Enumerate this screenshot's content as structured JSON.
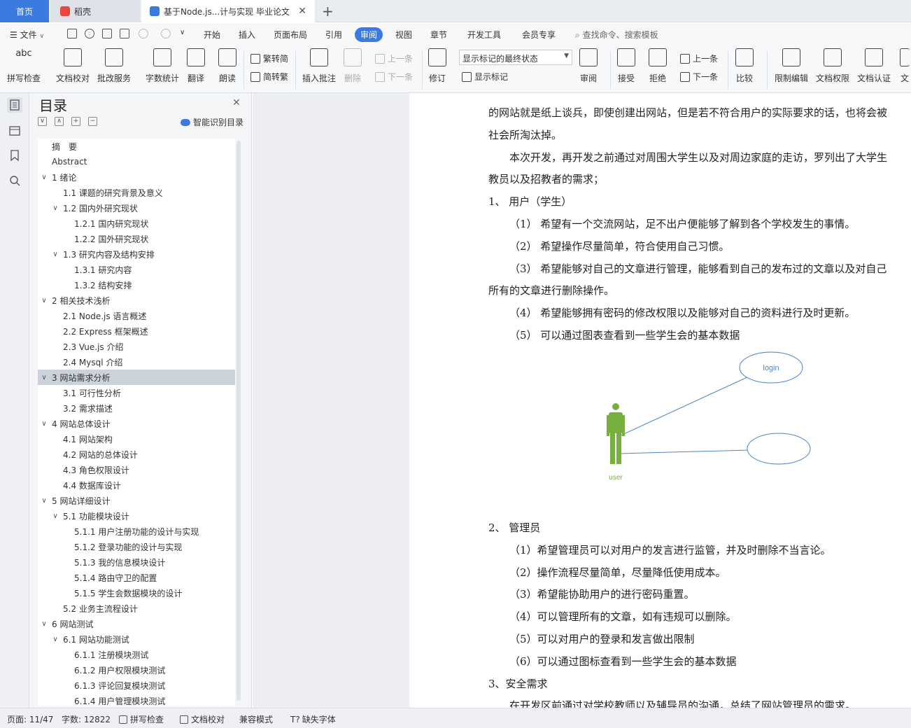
{
  "tabs": {
    "home": "首页",
    "daoke": "稻壳",
    "document": "基于Node.js...计与实现 毕业论文"
  },
  "menu": {
    "file": "文件",
    "items": [
      "开始",
      "插入",
      "页面布局",
      "引用",
      "审阅",
      "视图",
      "章节",
      "开发工具",
      "会员专享"
    ],
    "active": "审阅",
    "search_placeholder": "查找命令、搜索模板"
  },
  "ribbon": {
    "spell_check": "拼写检查",
    "doc_proofread": "文档校对",
    "batch_service": "批改服务",
    "word_count": "字数统计",
    "translate": "翻译",
    "read_aloud": "朗读",
    "to_traditional": "繁转简",
    "to_simplified": "简转繁",
    "insert_comment": "插入批注",
    "delete": "删除",
    "prev": "上一条",
    "next": "下一条",
    "revise": "修订",
    "markup_state": "显示标记的最终状态",
    "show_markup": "显示标记",
    "review": "审阅",
    "accept": "接受",
    "reject": "拒绝",
    "prev2": "上一条",
    "next2": "下一条",
    "compare": "比较",
    "restrict_edit": "限制编辑",
    "doc_rights": "文档权限",
    "doc_auth": "文档认证",
    "doc_cut": "文"
  },
  "toc": {
    "title": "目录",
    "smart": "智能识别目录",
    "items": [
      {
        "label": "摘　要",
        "level": 1,
        "chev": ""
      },
      {
        "label": "Abstract",
        "level": 1,
        "chev": ""
      },
      {
        "label": "1 绪论",
        "level": 1,
        "chev": "v"
      },
      {
        "label": "1.1  课题的研究背景及意义",
        "level": 2,
        "chev": ""
      },
      {
        "label": "1.2  国内外研究现状",
        "level": 2,
        "chev": "v"
      },
      {
        "label": "1.2.1 国内研究现状",
        "level": 3,
        "chev": ""
      },
      {
        "label": "1.2.2 国外研究现状",
        "level": 3,
        "chev": ""
      },
      {
        "label": "1.3  研究内容及结构安排",
        "level": 2,
        "chev": "v"
      },
      {
        "label": "1.3.1  研究内容",
        "level": 3,
        "chev": ""
      },
      {
        "label": "1.3.2  结构安排",
        "level": 3,
        "chev": ""
      },
      {
        "label": "2 相关技术浅析",
        "level": 1,
        "chev": "v"
      },
      {
        "label": "2.1 Node.js 语言概述",
        "level": 2,
        "chev": ""
      },
      {
        "label": "2.2 Express 框架概述",
        "level": 2,
        "chev": ""
      },
      {
        "label": "2.3 Vue.js 介绍",
        "level": 2,
        "chev": ""
      },
      {
        "label": "2.4 Mysql 介绍",
        "level": 2,
        "chev": ""
      },
      {
        "label": "3 网站需求分析",
        "level": 1,
        "chev": "v",
        "selected": true
      },
      {
        "label": "3.1 可行性分析",
        "level": 2,
        "chev": ""
      },
      {
        "label": "3.2 需求描述",
        "level": 2,
        "chev": ""
      },
      {
        "label": "4 网站总体设计",
        "level": 1,
        "chev": "v"
      },
      {
        "label": "4.1  网站架构",
        "level": 2,
        "chev": ""
      },
      {
        "label": "4.2  网站的总体设计",
        "level": 2,
        "chev": ""
      },
      {
        "label": "4.3  角色权限设计",
        "level": 2,
        "chev": ""
      },
      {
        "label": "4.4  数据库设计",
        "level": 2,
        "chev": ""
      },
      {
        "label": "5 网站详细设计",
        "level": 1,
        "chev": "v"
      },
      {
        "label": "5.1  功能模块设计",
        "level": 2,
        "chev": "v"
      },
      {
        "label": "5.1.1  用户注册功能的设计与实现",
        "level": 3,
        "chev": ""
      },
      {
        "label": "5.1.2  登录功能的设计与实现",
        "level": 3,
        "chev": ""
      },
      {
        "label": "5.1.3  我的信息模块设计",
        "level": 3,
        "chev": ""
      },
      {
        "label": "5.1.4  路由守卫的配置",
        "level": 3,
        "chev": ""
      },
      {
        "label": "5.1.5  学生会数据模块的设计",
        "level": 3,
        "chev": ""
      },
      {
        "label": "5.2 业务主流程设计",
        "level": 2,
        "chev": ""
      },
      {
        "label": "6 网站测试",
        "level": 1,
        "chev": "v"
      },
      {
        "label": "6.1  网站功能测试",
        "level": 2,
        "chev": "v"
      },
      {
        "label": "6.1.1  注册模块测试",
        "level": 3,
        "chev": ""
      },
      {
        "label": "6.1.2  用户权限模块测试",
        "level": 3,
        "chev": ""
      },
      {
        "label": "6.1.3  评论回复模块测试",
        "level": 3,
        "chev": ""
      },
      {
        "label": "6.1.4  用户管理模块测试",
        "level": 3,
        "chev": ""
      }
    ]
  },
  "document": {
    "lines": [
      {
        "text": "的网站就是纸上谈兵，即使创建出网站，但是若不符合用户的实际要求的话，也将会被",
        "indent": 0
      },
      {
        "text": "社会所淘汰掉。",
        "indent": 0
      },
      {
        "text": "本次开发，再开发之前通过对周围大学生以及对周边家庭的走访，罗列出了大学生",
        "indent": 2
      },
      {
        "text": "教员以及招教者的需求；",
        "indent": 0
      },
      {
        "text": "1、  用户（学生）",
        "indent": 0
      },
      {
        "text": "（1）  希望有一个交流网站，足不出户便能够了解到各个学校发生的事情。",
        "indent": 2
      },
      {
        "text": "（2）  希望操作尽量简单，符合使用自己习惯。",
        "indent": 2
      },
      {
        "text": "（3）  希望能够对自己的文章进行管理，能够看到自己的发布过的文章以及对自己",
        "indent": 2
      },
      {
        "text": "所有的文章进行删除操作。",
        "indent": 0
      },
      {
        "text": "（4）  希望能够拥有密码的修改权限以及能够对自己的资料进行及时更新。",
        "indent": 2
      },
      {
        "text": "（5）  可以通过图表查看到一些学生会的基本数据",
        "indent": 2
      }
    ],
    "diagram": {
      "actor_label": "user",
      "usecase_label": "login"
    },
    "lines2": [
      {
        "text": "2、  管理员",
        "indent": 0
      },
      {
        "text": "（1）希望管理员可以对用户的发言进行监管，并及时删除不当言论。",
        "indent": 2
      },
      {
        "text": "（2）操作流程尽量简单，尽量降低使用成本。",
        "indent": 2
      },
      {
        "text": "（3）希望能协助用户的进行密码重置。",
        "indent": 2
      },
      {
        "text": "（4）可以管理所有的文章，如有违规可以删除。",
        "indent": 2
      },
      {
        "text": "（5）可以对用户的登录和发言做出限制",
        "indent": 2
      },
      {
        "text": "（6）可以通过图标查看到一些学生会的基本数据",
        "indent": 2
      },
      {
        "text": "3、安全需求",
        "indent": 0
      },
      {
        "text": "在开发区前通过对学校教师以及辅导员的沟通，总结了网站管理员的需求。",
        "indent": 2
      }
    ]
  },
  "status": {
    "page": "页面: 11/47",
    "words": "字数: 12822",
    "spell": "拼写检查",
    "proof": "文档校对",
    "compat": "兼容模式",
    "missing_font": "缺失字体"
  },
  "colors": {
    "accent": "#3b7be0",
    "actor": "#77b03e",
    "usecase": "#4a86c5"
  }
}
